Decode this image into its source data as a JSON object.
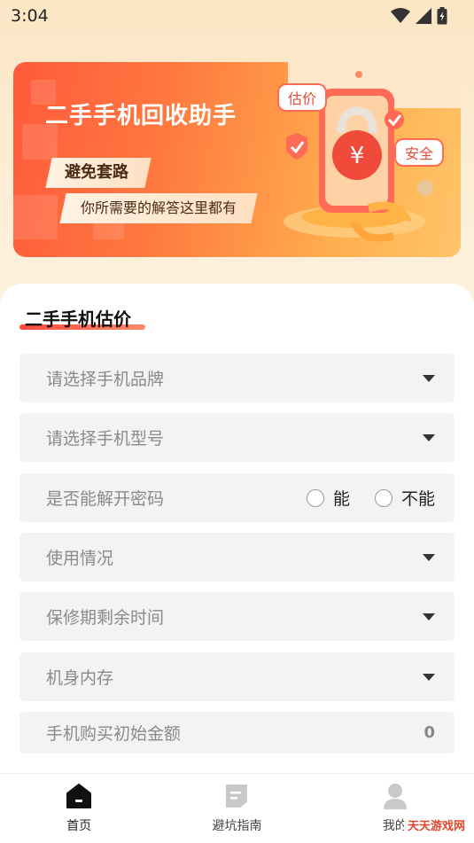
{
  "status_bar": {
    "time": "3:04"
  },
  "banner": {
    "title": "二手手机回收助手",
    "tag1": "避免套路",
    "tag2": "你所需要的解答这里都有",
    "bubble_estimate": "估价",
    "bubble_safe": "安全",
    "coin_symbol": "¥"
  },
  "form": {
    "section_title": "二手手机估价",
    "fields": [
      {
        "label": "请选择手机品牌",
        "control": "dropdown"
      },
      {
        "label": "请选择手机型号",
        "control": "dropdown"
      },
      {
        "label": "是否能解开密码",
        "control": "radio",
        "options": [
          "能",
          "不能"
        ]
      },
      {
        "label": "使用情况",
        "control": "dropdown"
      },
      {
        "label": "保修期剩余时间",
        "control": "dropdown"
      },
      {
        "label": "机身内存",
        "control": "dropdown"
      },
      {
        "label": "手机购买初始金额",
        "control": "number",
        "value": "0"
      }
    ]
  },
  "tabbar": {
    "items": [
      {
        "label": "首页",
        "icon": "home-icon",
        "active": true
      },
      {
        "label": "避坑指南",
        "icon": "document-icon",
        "active": false
      },
      {
        "label": "我的",
        "icon": "user-icon",
        "active": false
      }
    ]
  },
  "watermark": "天天游戏网",
  "colors": {
    "accent": "#ff4a3a",
    "banner_start": "#ff5a3c",
    "banner_end": "#ffc46a"
  }
}
